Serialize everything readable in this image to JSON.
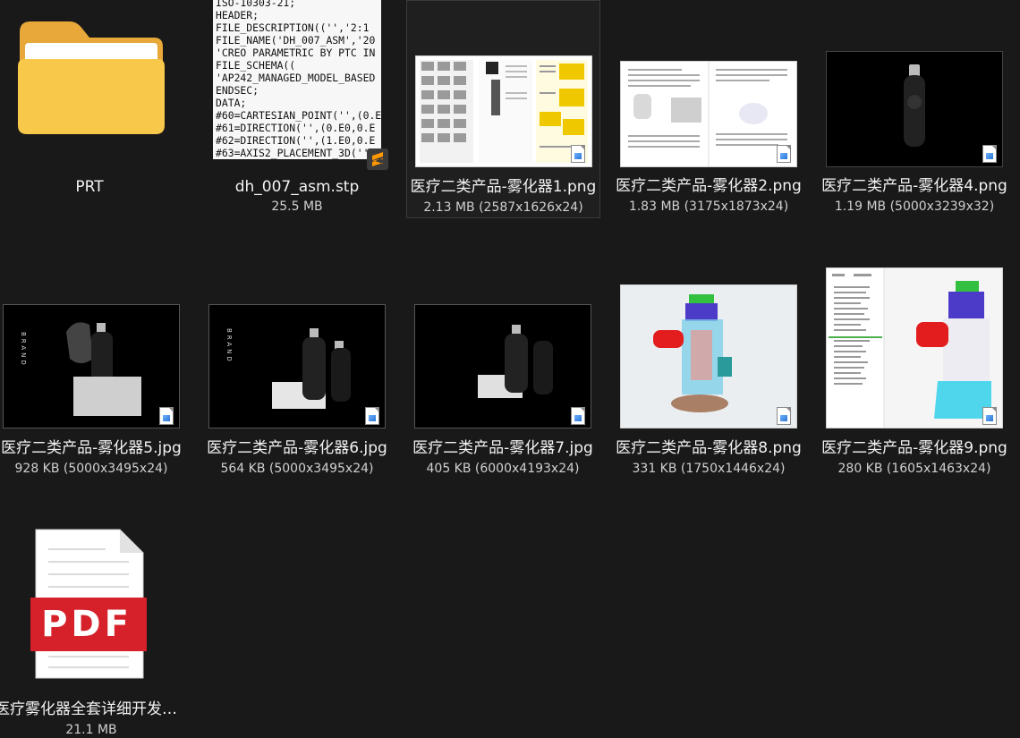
{
  "files": [
    {
      "name": "PRT",
      "meta": ""
    },
    {
      "name": "dh_007_asm.stp",
      "meta": "25.5 MB"
    },
    {
      "name": "医疗二类产品-雾化器1.png",
      "meta": "2.13 MB (2587x1626x24)"
    },
    {
      "name": "医疗二类产品-雾化器2.png",
      "meta": "1.83 MB (3175x1873x24)"
    },
    {
      "name": "医疗二类产品-雾化器4.png",
      "meta": "1.19 MB (5000x3239x32)"
    },
    {
      "name": "医疗二类产品-雾化器5.jpg",
      "meta": "928 KB (5000x3495x24)"
    },
    {
      "name": "医疗二类产品-雾化器6.jpg",
      "meta": "564 KB (5000x3495x24)"
    },
    {
      "name": "医疗二类产品-雾化器7.jpg",
      "meta": "405 KB (6000x4193x24)"
    },
    {
      "name": "医疗二类产品-雾化器8.png",
      "meta": "331 KB (1750x1446x24)"
    },
    {
      "name": "医疗二类产品-雾化器9.png",
      "meta": "280 KB (1605x1463x24)"
    },
    {
      "name": "医疗雾化器全套详细开发资料.pdf",
      "meta": "21.1 MB"
    }
  ],
  "stp_preview_lines": [
    "ISO-10303-21;",
    "HEADER;",
    "FILE_DESCRIPTION(('','2:1",
    "FILE_NAME('DH_007_ASM','20",
    "'CREO PARAMETRIC BY PTC IN",
    "FILE_SCHEMA((",
    "'AP242_MANAGED_MODEL_BASED",
    "ENDSEC;",
    "DATA;",
    "#60=CARTESIAN_POINT('',(0.E",
    "#61=DIRECTION('',(0.E0,0.E",
    "#62=DIRECTION('',(1.E0,0.E",
    "#63=AXIS2_PLACEMENT_3D('',#"
  ],
  "pdf_label": "PDF",
  "brand_text": "BRAND",
  "colors": {
    "background": "#191919",
    "pdf_red": "#d6202a",
    "folder": "#f5c542"
  }
}
